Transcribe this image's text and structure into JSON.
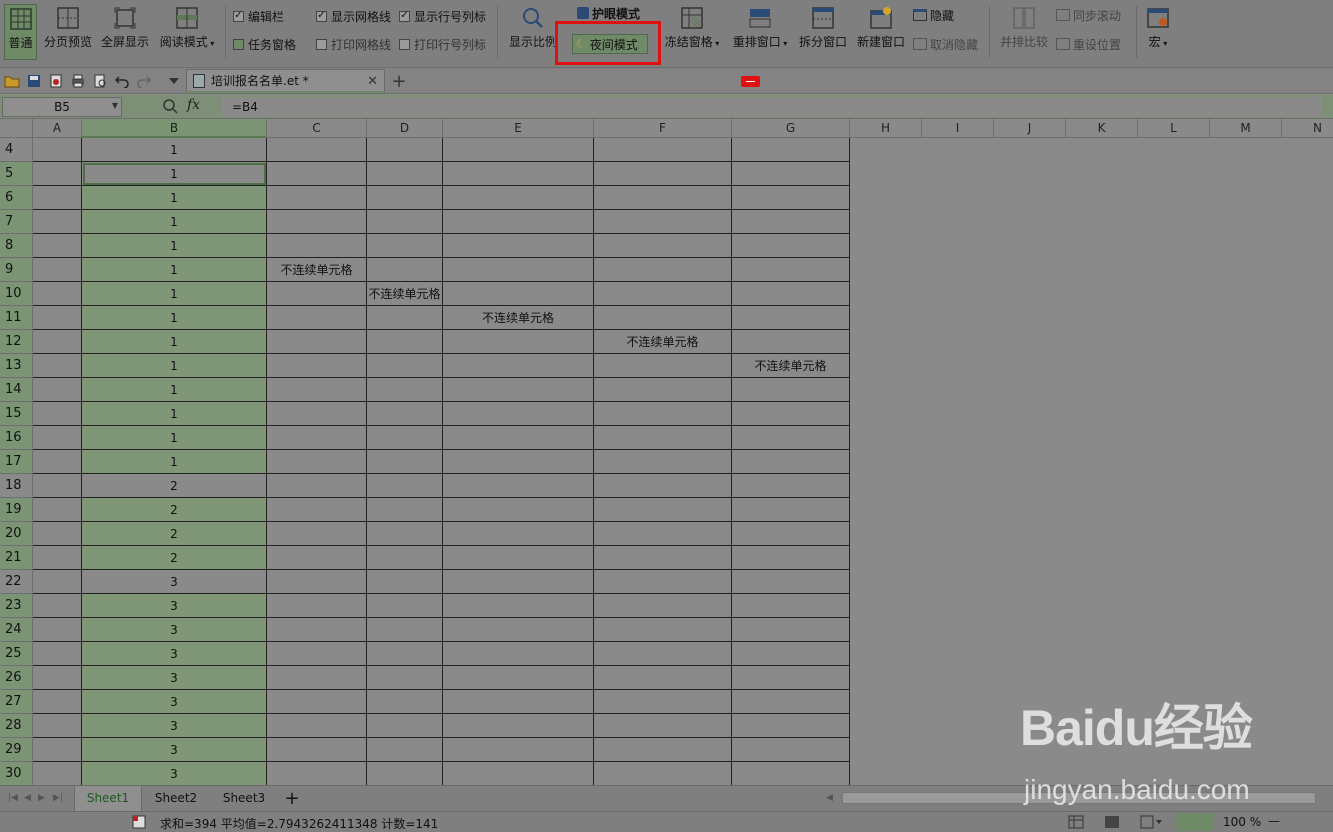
{
  "ribbon": {
    "buttons": {
      "normal": "普通",
      "page_break_preview": "分页预览",
      "full_screen": "全屏显示",
      "reading_mode": "阅读模式",
      "zoom": "显示比例",
      "eye_protection": "护眼模式",
      "night_mode": "夜间模式",
      "freeze_panes": "冻结窗格",
      "arrange_windows": "重排窗口",
      "split_window": "拆分窗口",
      "new_window": "新建窗口",
      "hide": "隐藏",
      "unhide": "取消隐藏",
      "side_by_side": "并排比较",
      "sync_scroll": "同步滚动",
      "reset_position": "重设位置",
      "macro": "宏"
    },
    "checkboxes": {
      "edit_bar": "编辑栏",
      "task_pane": "任务窗格",
      "show_gridlines": "显示网格线",
      "print_gridlines": "打印网格线",
      "show_headers": "显示行号列标",
      "print_headers": "打印行号列标"
    }
  },
  "doc_tab": {
    "title": "培训报名名单.et *"
  },
  "formula_bar": {
    "cell_ref": "B5",
    "fx": "fx",
    "formula": "=B4"
  },
  "grid": {
    "columns": [
      "A",
      "B",
      "C",
      "D",
      "E",
      "F",
      "G",
      "H",
      "I",
      "J",
      "K",
      "L",
      "M",
      "N"
    ],
    "rows": [
      4,
      5,
      6,
      7,
      8,
      9,
      10,
      11,
      12,
      13,
      14,
      15,
      16,
      17,
      18,
      19,
      20,
      21,
      22,
      23,
      24,
      25,
      26,
      27,
      28,
      29,
      30
    ],
    "b_values": [
      "1",
      "1",
      "1",
      "1",
      "1",
      "1",
      "1",
      "1",
      "1",
      "1",
      "1",
      "1",
      "1",
      "1",
      "2",
      "2",
      "2",
      "2",
      "3",
      "3",
      "3",
      "3",
      "3",
      "3",
      "3",
      "3",
      "3"
    ],
    "selected_b_rows": [
      5,
      6,
      7,
      8,
      9,
      10,
      11,
      12,
      13,
      14,
      15,
      16,
      17,
      19,
      20,
      21,
      23,
      24,
      25,
      26,
      27,
      28,
      29,
      30
    ],
    "noncontiguous_label": "不连续单元格",
    "noncontiguous_cells": [
      {
        "col": "C",
        "row": 9
      },
      {
        "col": "D",
        "row": 10
      },
      {
        "col": "E",
        "row": 11
      },
      {
        "col": "F",
        "row": 12
      },
      {
        "col": "G",
        "row": 13
      }
    ]
  },
  "sheets": [
    "Sheet1",
    "Sheet2",
    "Sheet3"
  ],
  "status": {
    "text": "求和=394  平均值=2.7943262411348  计数=141",
    "zoom": "100 %"
  },
  "watermark": {
    "logo": "Baidu经验",
    "url": "jingyan.baidu.com"
  }
}
